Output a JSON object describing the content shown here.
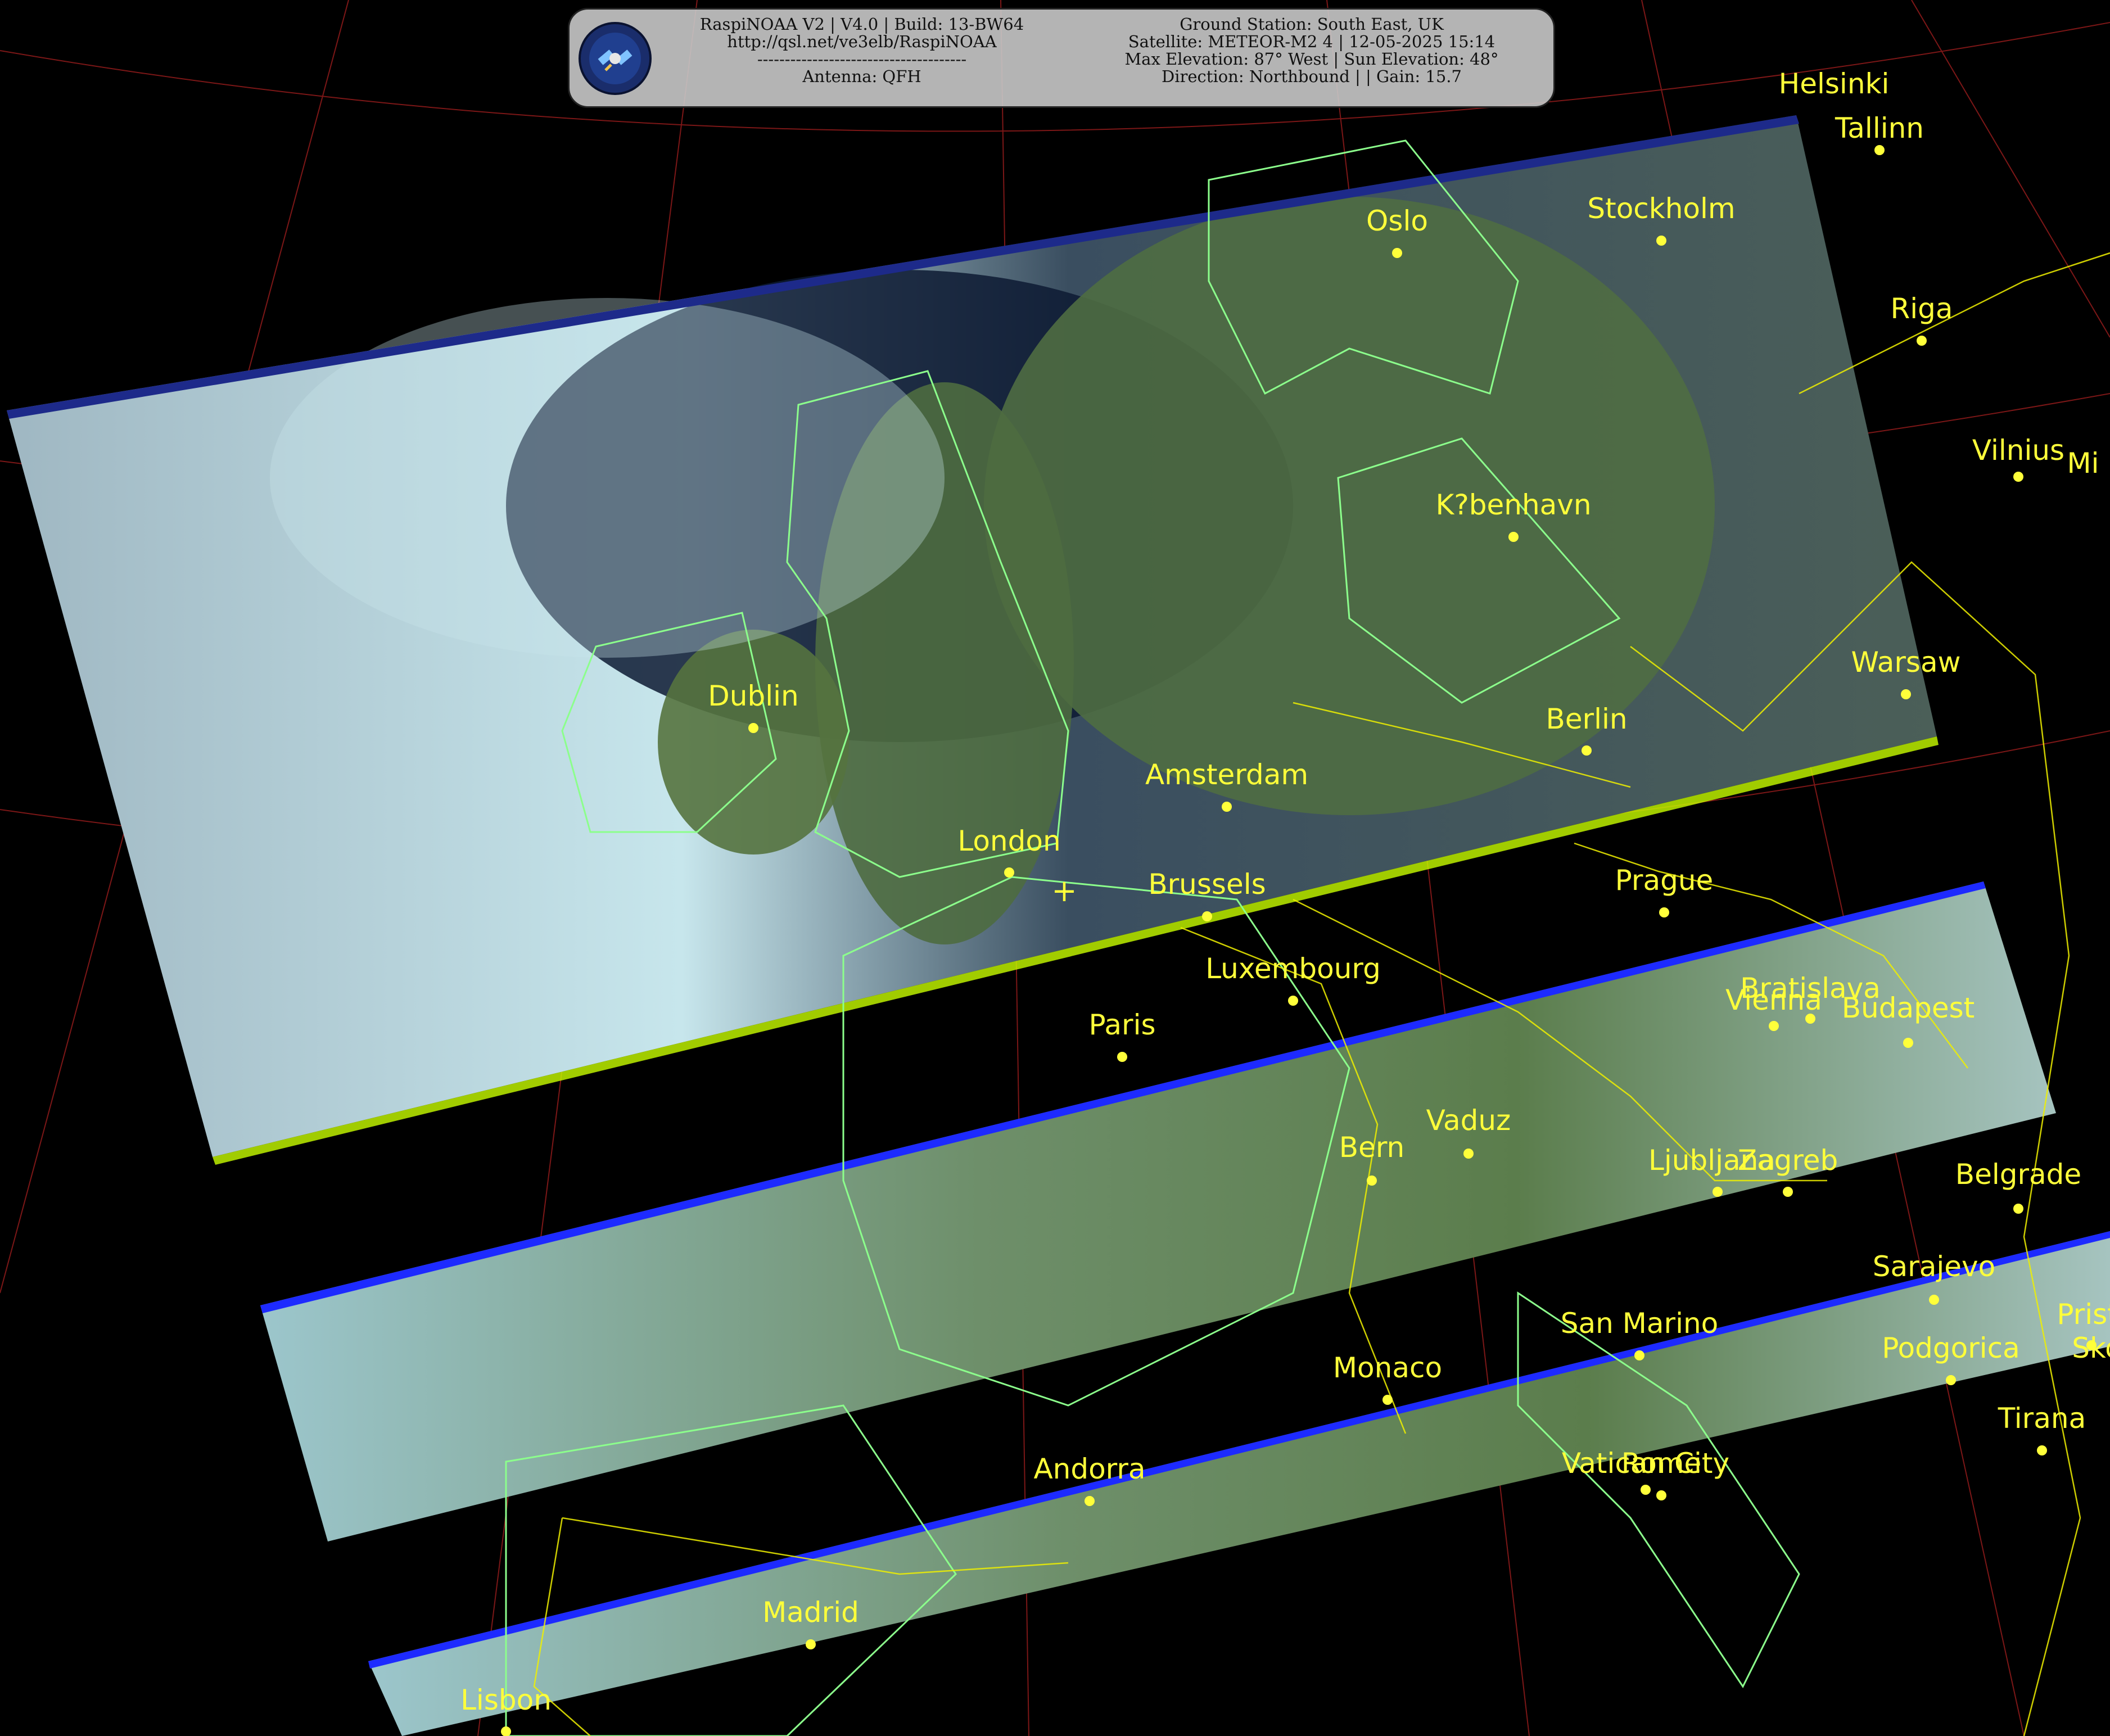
{
  "header": {
    "left": [
      "RaspiNOAA V2 | V4.0 | Build: 13-BW64",
      "http://qsl.net/ve3elb/RaspiNOAA",
      "--------------------------------------",
      "Antenna: QFH"
    ],
    "right": [
      "Ground Station: South East, UK",
      "Satellite: METEOR-M2 4 | 12-05-2025 15:14",
      "Max Elevation: 87° West | Sun Elevation: 48°",
      "Direction: Northbound | | Gain: 15.7"
    ]
  },
  "logo_icon": "satellite-icon",
  "ground_station_marker": "+",
  "colors": {
    "label": "#ffff3a",
    "coastline": "#8cff8c",
    "border": "#f0f000",
    "grid": "#8a1a1a"
  },
  "cities": [
    {
      "name": "Helsinki"
    },
    {
      "name": "Tallinn"
    },
    {
      "name": "Oslo"
    },
    {
      "name": "Stockholm"
    },
    {
      "name": "Riga"
    },
    {
      "name": "Vilnius"
    },
    {
      "name": "Mi"
    },
    {
      "name": "K?benhavn"
    },
    {
      "name": "Dublin"
    },
    {
      "name": "Warsaw"
    },
    {
      "name": "Berlin"
    },
    {
      "name": "Amsterdam"
    },
    {
      "name": "London"
    },
    {
      "name": "Brussels"
    },
    {
      "name": "Prague"
    },
    {
      "name": "Luxembourg"
    },
    {
      "name": "Paris"
    },
    {
      "name": "Bratislava"
    },
    {
      "name": "Vienna"
    },
    {
      "name": "Budapest"
    },
    {
      "name": "Vaduz"
    },
    {
      "name": "Bern"
    },
    {
      "name": "Ljubljana"
    },
    {
      "name": "Zagreb"
    },
    {
      "name": "Belgrade"
    },
    {
      "name": "Sarajevo"
    },
    {
      "name": "Pristi"
    },
    {
      "name": "San Marino"
    },
    {
      "name": "Podgorica"
    },
    {
      "name": "Sko"
    },
    {
      "name": "Monaco"
    },
    {
      "name": "Tirana"
    },
    {
      "name": "Vatican City"
    },
    {
      "name": "Rome"
    },
    {
      "name": "Andorra"
    },
    {
      "name": "Madrid"
    },
    {
      "name": "Lisbon"
    }
  ]
}
